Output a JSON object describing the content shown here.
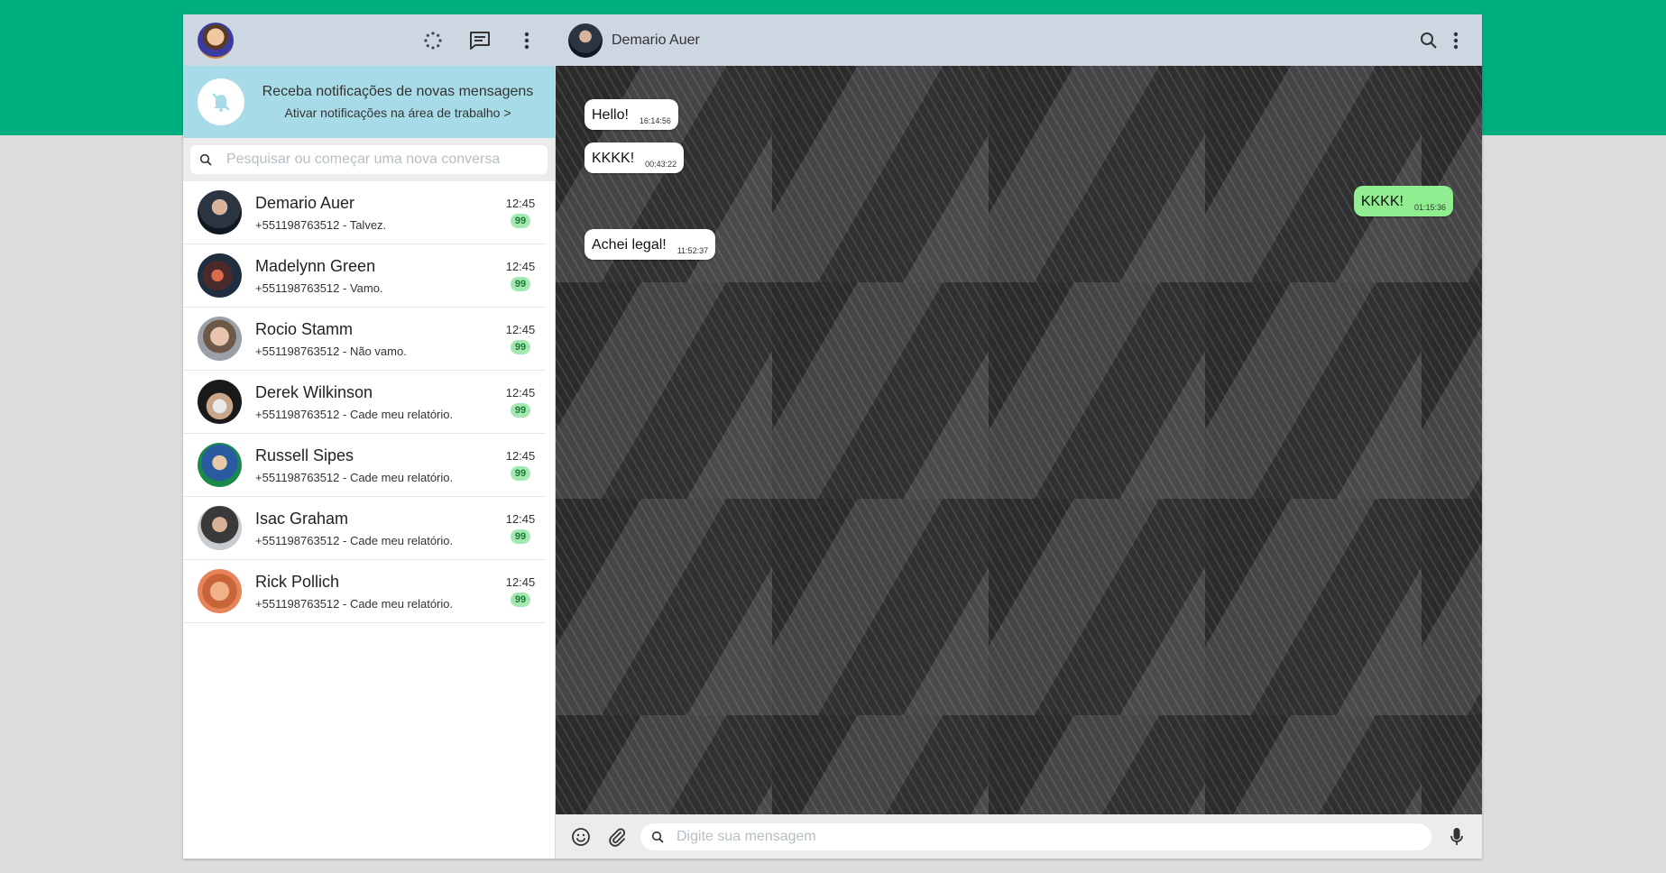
{
  "sidebar": {
    "notification": {
      "title": "Receba notificações de novas mensagens",
      "link": "Ativar notificações na área de trabalho >"
    },
    "search": {
      "placeholder": "Pesquisar ou começar uma nova conversa"
    },
    "chats": [
      {
        "name": "Demario Auer",
        "last": "+551198763512 - Talvez.",
        "time": "12:45",
        "unread": "99"
      },
      {
        "name": "Madelynn Green",
        "last": "+551198763512 - Vamo.",
        "time": "12:45",
        "unread": "99"
      },
      {
        "name": "Rocio Stamm",
        "last": "+551198763512 - Não vamo.",
        "time": "12:45",
        "unread": "99"
      },
      {
        "name": "Derek Wilkinson",
        "last": "+551198763512 - Cade meu relatório.",
        "time": "12:45",
        "unread": "99"
      },
      {
        "name": "Russell Sipes",
        "last": "+551198763512 - Cade meu relatório.",
        "time": "12:45",
        "unread": "99"
      },
      {
        "name": "Isac Graham",
        "last": "+551198763512 - Cade meu relatório.",
        "time": "12:45",
        "unread": "99"
      },
      {
        "name": "Rick Pollich",
        "last": "+551198763512 - Cade meu relatório.",
        "time": "12:45",
        "unread": "99"
      }
    ]
  },
  "conversation": {
    "contact_name": "Demario Auer",
    "messages": [
      {
        "text": "Hello!",
        "time": "16:14:56",
        "direction": "in"
      },
      {
        "text": "KKKK!",
        "time": "00:43:22",
        "direction": "in"
      },
      {
        "text": "KKKK!",
        "time": "01:15:36",
        "direction": "out"
      },
      {
        "text": "Achei legal!",
        "time": "11:52:37",
        "direction": "in"
      }
    ]
  },
  "composer": {
    "placeholder": "Digite sua mensagem"
  },
  "colors": {
    "brand": "#00af80",
    "header": "#cdd7e1",
    "notification_bg": "#a8dbe8",
    "outgoing_bubble": "#90ee90",
    "badge": "#a3e8b0"
  },
  "icons": {
    "status": "status-icon",
    "new_chat": "new-chat-icon",
    "menu": "more-vertical-icon",
    "notifications_off": "bell-off-icon",
    "search": "search-icon",
    "emoji": "emoji-icon",
    "attach": "paperclip-icon",
    "mic": "microphone-icon"
  }
}
